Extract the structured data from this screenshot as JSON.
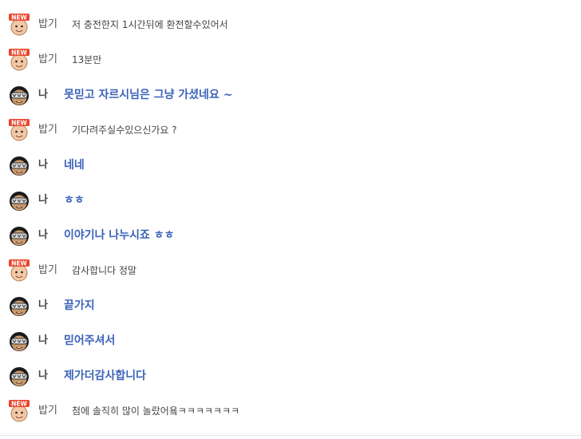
{
  "chat": {
    "messages": [
      {
        "sender": "밥기",
        "me": false,
        "text": "저 충전한지 1시간뒤에 환전할수있어서"
      },
      {
        "sender": "밥기",
        "me": false,
        "text": "13분만"
      },
      {
        "sender": "나",
        "me": true,
        "text": "못믿고 자르시님은 그냥 가셨네요 ~"
      },
      {
        "sender": "밥기",
        "me": false,
        "text": "기다려주실수있으신가요 ?"
      },
      {
        "sender": "나",
        "me": true,
        "text": "네네"
      },
      {
        "sender": "나",
        "me": true,
        "text": "ㅎㅎ"
      },
      {
        "sender": "나",
        "me": true,
        "text": "이야기나 나누시죠 ㅎㅎ"
      },
      {
        "sender": "밥기",
        "me": false,
        "text": "감사합니다 정말"
      },
      {
        "sender": "나",
        "me": true,
        "text": "끝가지"
      },
      {
        "sender": "나",
        "me": true,
        "text": "믿어주셔서"
      },
      {
        "sender": "나",
        "me": true,
        "text": "제가더감사합니다"
      },
      {
        "sender": "밥기",
        "me": false,
        "text": "첨에 솔직히 많이 놀랐어욬ㅋㅋㅋㅋㅋㅋㅋ"
      }
    ]
  },
  "avatars": {
    "new_badge_text": "NEW",
    "new_badge_color": "#e8452c",
    "skin_color": "#f3c7a4",
    "me_hair_color": "#1a1a1a",
    "me_glasses_color": "#d9d9d9",
    "me_skin_color": "#c99a6a"
  },
  "colors": {
    "my_message": "#3b63b8",
    "other_message": "#444444"
  }
}
